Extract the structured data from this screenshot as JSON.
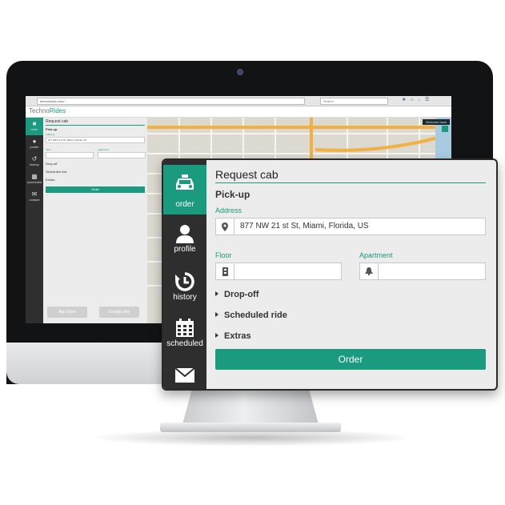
{
  "colors": {
    "accent": "#1a9a7e",
    "sidebar": "#2e2e2e",
    "panel": "#ececec"
  },
  "browser": {
    "url": "technorides.com/...",
    "search_placeholder": "Search"
  },
  "site": {
    "logo_prefix": "Techno",
    "logo_suffix": "Rides",
    "welcome": "Welcome back"
  },
  "mini": {
    "sidebar": [
      {
        "label": "order",
        "icon": "taxi-icon"
      },
      {
        "label": "profile",
        "icon": "user-icon"
      },
      {
        "label": "history",
        "icon": "history-icon"
      },
      {
        "label": "scheduled",
        "icon": "calendar-icon"
      },
      {
        "label": "contact",
        "icon": "envelope-icon"
      }
    ],
    "title": "Request cab",
    "section": "Pick-up",
    "address_label": "Address",
    "address_value": "877 NW 21 st St, Miami, Florida, US",
    "floor_label": "Floor",
    "apartment_label": "Apartment",
    "dropoff": "Drop-off",
    "scheduled": "Scheduled ride",
    "extras": "Extras",
    "order": "Order",
    "app_store": "App Store",
    "google_play": "Google play"
  },
  "popup": {
    "sidebar": [
      {
        "label": "order",
        "icon": "taxi-icon"
      },
      {
        "label": "profile",
        "icon": "user-icon"
      },
      {
        "label": "history",
        "icon": "history-icon"
      },
      {
        "label": "scheduled",
        "icon": "calendar-icon"
      },
      {
        "label": "",
        "icon": "envelope-icon"
      }
    ],
    "title": "Request cab",
    "section": "Pick-up",
    "address_label": "Address",
    "address_value": "877  NW 21 st St, Miami, Florida, US",
    "floor_label": "Floor",
    "floor_value": "",
    "apartment_label": "Apartment",
    "apartment_value": "",
    "dropoff": "Drop-off",
    "scheduled": "Scheduled ride",
    "extras": "Extras",
    "order_button": "Order"
  }
}
